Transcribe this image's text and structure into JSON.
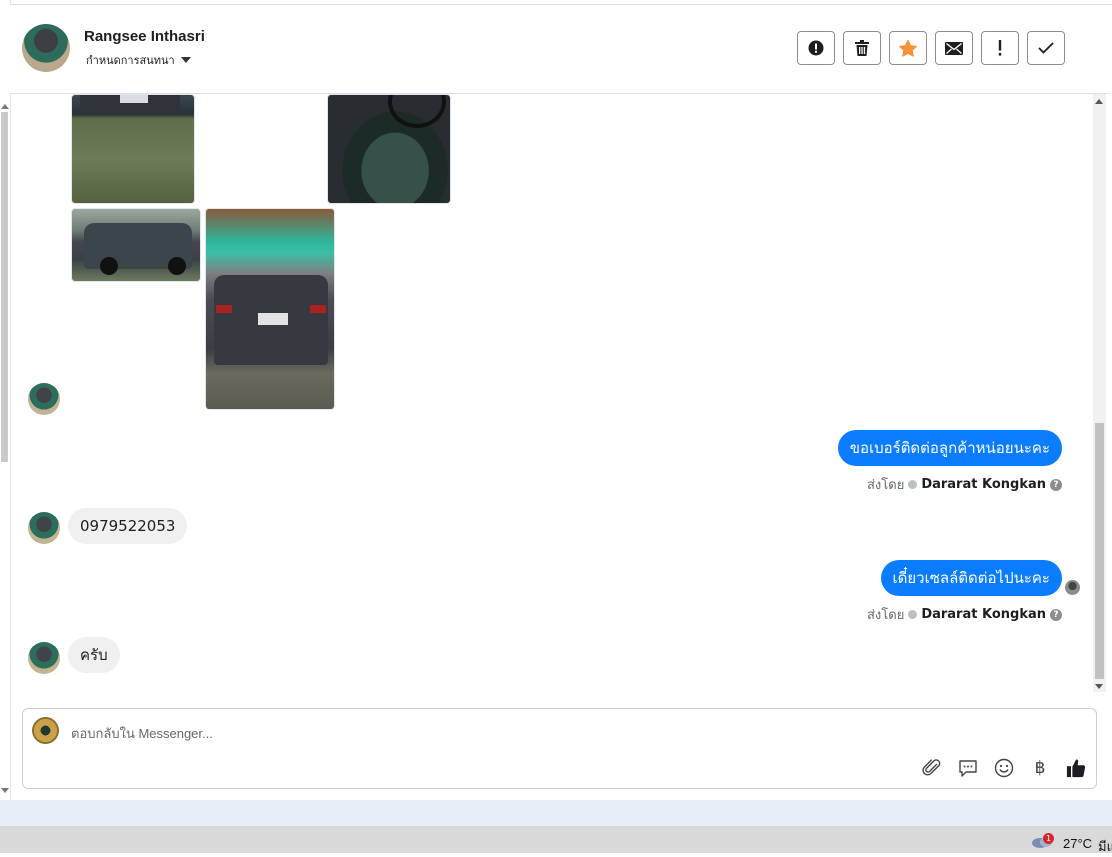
{
  "header": {
    "contact_name": "Rangsee Inthasri",
    "conversation_settings": "กำหนดการสนทนา",
    "actions": [
      {
        "name": "spam-button",
        "icon": "alert-circle-icon"
      },
      {
        "name": "delete-button",
        "icon": "trash-icon"
      },
      {
        "name": "star-button",
        "icon": "star-icon"
      },
      {
        "name": "mark-unread-button",
        "icon": "envelope-icon"
      },
      {
        "name": "follow-up-button",
        "icon": "exclamation-icon"
      },
      {
        "name": "mark-done-button",
        "icon": "checkmark-icon"
      }
    ]
  },
  "colors": {
    "outgoing_bubble": "#0a7cff",
    "incoming_bubble": "#f0f0f0",
    "star": "#f7923b"
  },
  "messages": [
    {
      "direction": "outgoing",
      "text": "ขอเบอร์ติดต่อลูกค้าหน่อยนะคะ",
      "sent_by_prefix": "ส่งโดย",
      "sent_by": "Dararat Kongkan"
    },
    {
      "direction": "incoming",
      "text": "0979522053"
    },
    {
      "direction": "outgoing",
      "text": "เดี๋ยวเซลล์ติดต่อไปนะคะ",
      "sent_by_prefix": "ส่งโดย",
      "sent_by": "Dararat Kongkan"
    },
    {
      "direction": "incoming",
      "text": "ครับ"
    }
  ],
  "composer": {
    "placeholder": "ตอบกลับใน Messenger...",
    "tools": [
      "paperclip-icon",
      "speech-bubble-icon",
      "smiley-icon",
      "baht-icon",
      "thumbs-up-icon"
    ],
    "baht_symbol": "฿"
  },
  "taskbar": {
    "weather_badge": "1",
    "temperature": "27°C",
    "clipped_text": "มีแ"
  }
}
